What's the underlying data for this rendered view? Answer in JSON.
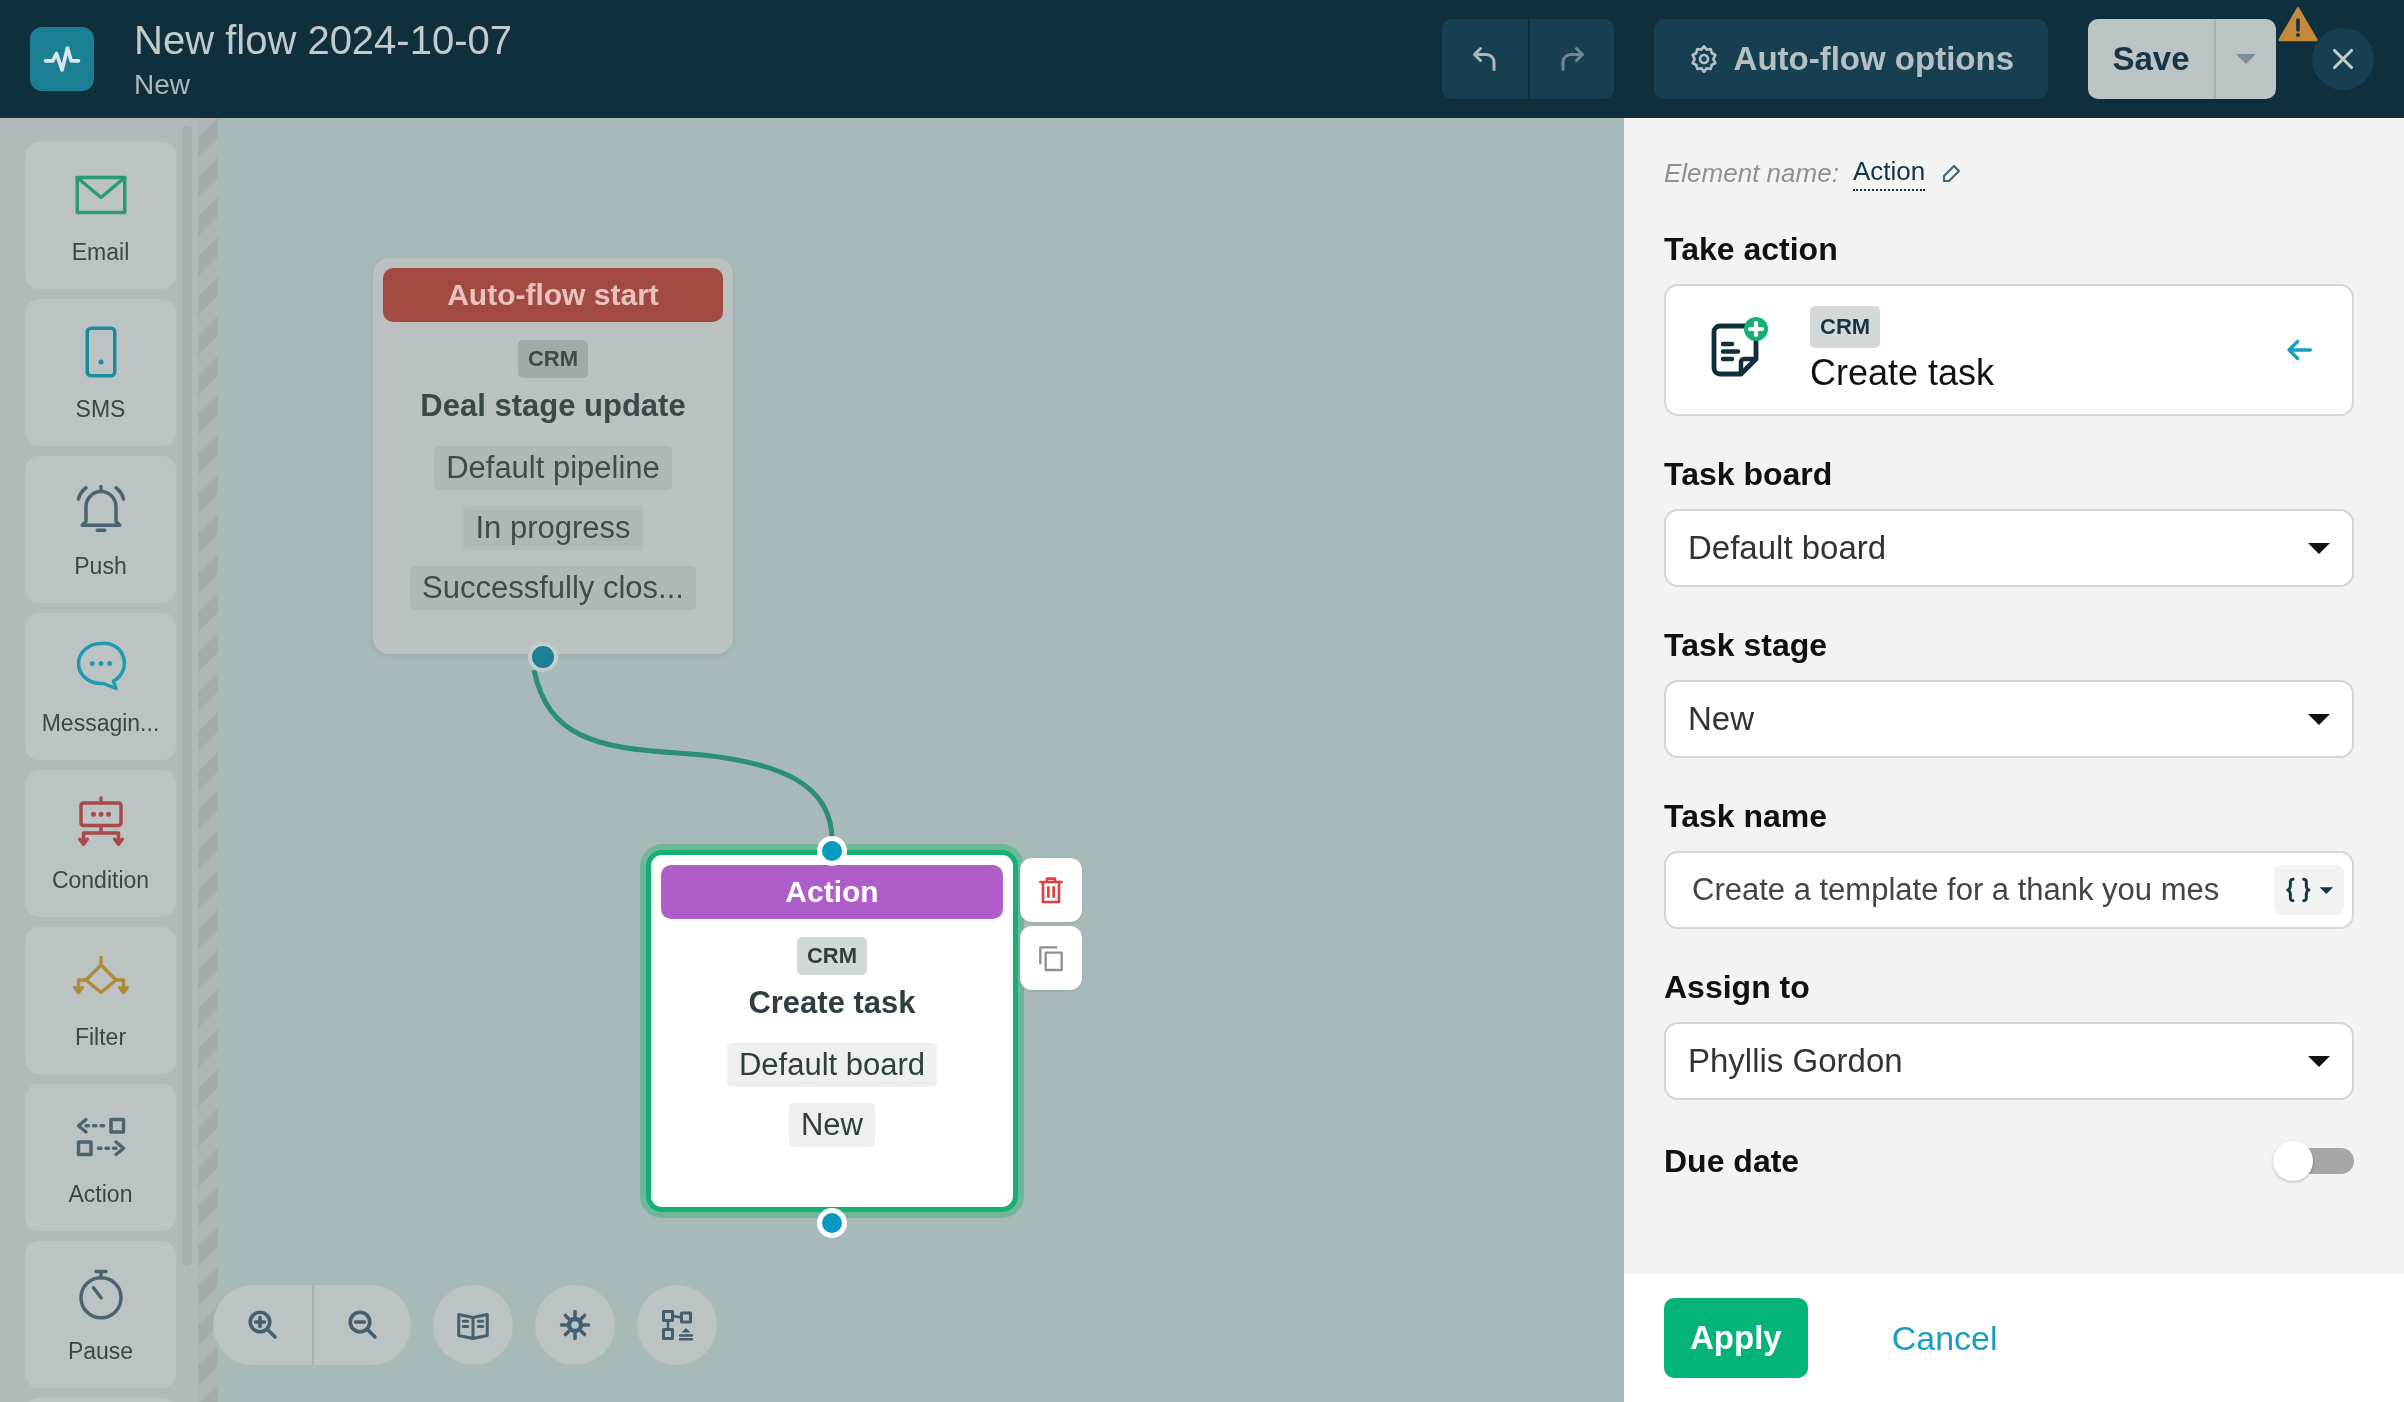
{
  "header": {
    "title": "New flow 2024-10-07",
    "subtitle": "New",
    "options_button": "Auto-flow options",
    "save_button": "Save",
    "warning": true
  },
  "sidebar": {
    "items": [
      {
        "label": "Email"
      },
      {
        "label": "SMS"
      },
      {
        "label": "Push"
      },
      {
        "label": "Messagin..."
      },
      {
        "label": "Condition"
      },
      {
        "label": "Filter"
      },
      {
        "label": "Action"
      },
      {
        "label": "Pause"
      }
    ]
  },
  "canvas": {
    "nodes": [
      {
        "kind": "start",
        "selected": false,
        "header": "Auto-flow start",
        "tag": "CRM",
        "title": "Deal stage update",
        "chips": [
          "Default pipeline",
          "In progress",
          "Successfully clos..."
        ]
      },
      {
        "kind": "action",
        "selected": true,
        "header": "Action",
        "tag": "CRM",
        "title": "Create task",
        "chips": [
          "Default board",
          "New"
        ]
      }
    ]
  },
  "panel": {
    "element_name_label": "Element name:",
    "element_name": "Action",
    "take_action": {
      "label": "Take action",
      "tag": "CRM",
      "title": "Create task"
    },
    "fields": [
      {
        "kind": "select",
        "label": "Task board",
        "value": "Default board"
      },
      {
        "kind": "select",
        "label": "Task stage",
        "value": "New"
      },
      {
        "kind": "text",
        "label": "Task name",
        "value": "Create a template for a thank you mes"
      },
      {
        "kind": "select",
        "label": "Assign to",
        "value": "Phyllis Gordon"
      },
      {
        "kind": "toggle",
        "label": "Due date",
        "on": false
      }
    ],
    "apply_button": "Apply",
    "cancel_button": "Cancel"
  }
}
